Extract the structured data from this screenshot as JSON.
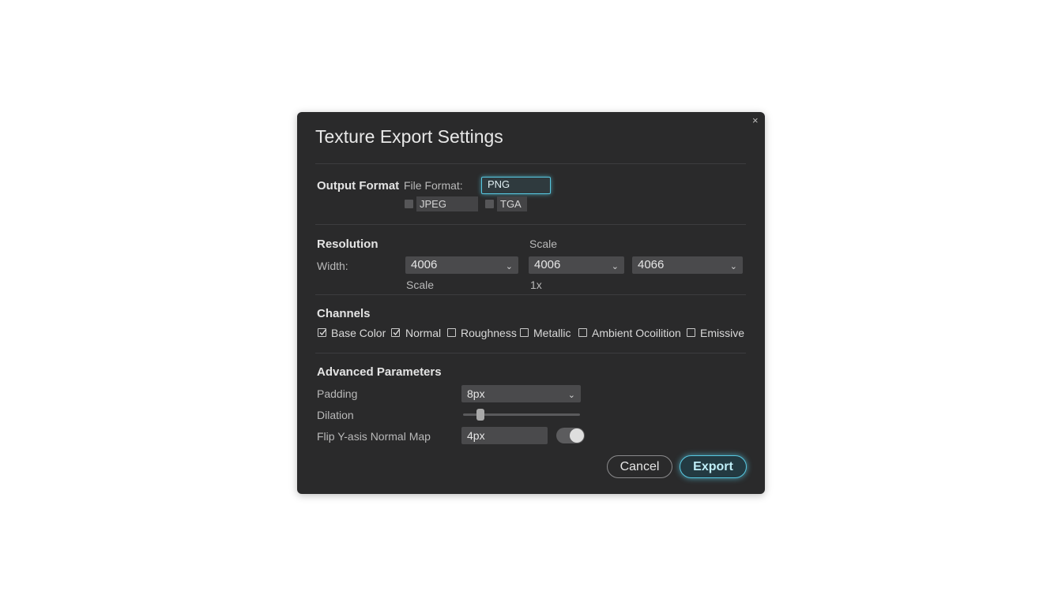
{
  "dialog": {
    "title": "Texture Export Settings",
    "close_glyph": "×"
  },
  "output_format": {
    "section_label": "Output Format",
    "file_format_label": "File Format:",
    "selected": "PNG",
    "options": [
      {
        "label": "JPEG",
        "checked": false
      },
      {
        "label": "TGA",
        "checked": false
      }
    ]
  },
  "resolution": {
    "section_label": "Resolution",
    "scale_header": "Scale",
    "width_label": "Width:",
    "width_value": "4006",
    "scale_value": "4006",
    "third_value": "4066",
    "scale_sublabel": "Scale",
    "scale_factor": "1x"
  },
  "channels": {
    "section_label": "Channels",
    "items": [
      {
        "label": "Base Color",
        "checked": true
      },
      {
        "label": "Normal",
        "checked": true
      },
      {
        "label": "Roughness",
        "checked": false
      },
      {
        "label": "Metallic",
        "checked": false
      },
      {
        "label": "Ambient Ocoilition",
        "checked": false
      },
      {
        "label": "Emissive",
        "checked": false
      }
    ]
  },
  "advanced": {
    "section_label": "Advanced Parameters",
    "padding_label": "Padding",
    "padding_value": "8px",
    "dilation_label": "Dilation",
    "dilation_level": 0.12,
    "flip_label": "Flip Y-asis Normal Map",
    "flip_value": "4px",
    "flip_toggle_on": true
  },
  "buttons": {
    "cancel": "Cancel",
    "export": "Export"
  },
  "colors": {
    "accent": "#57c7e0",
    "dialog_bg": "#2a2a2b",
    "field_bg": "#4a4a4c"
  }
}
